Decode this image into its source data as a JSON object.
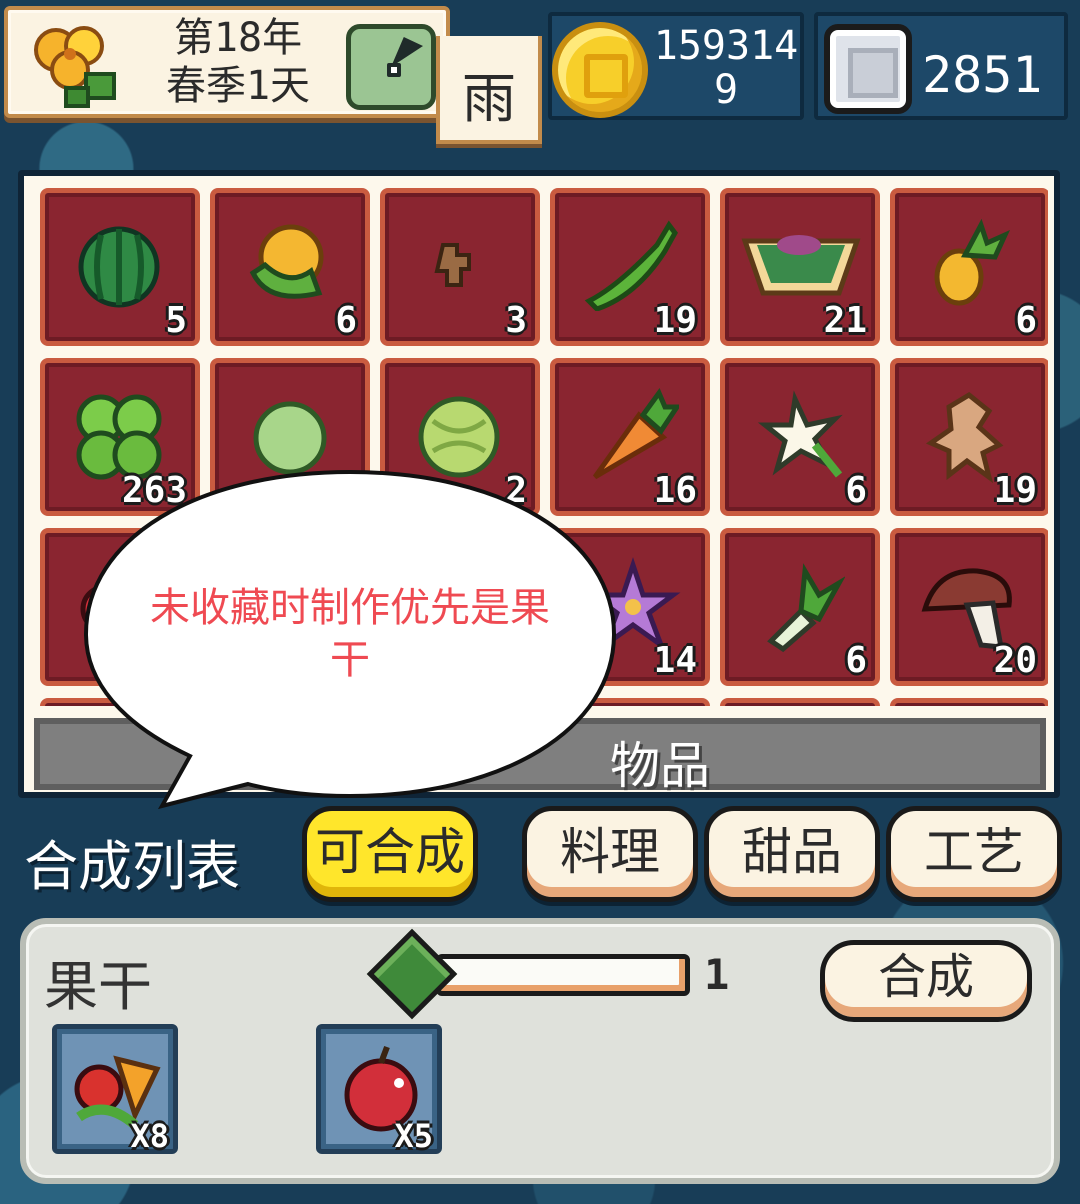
{
  "hud": {
    "date": {
      "year": "第18年",
      "season_day": "春季1天"
    },
    "weather": "雨",
    "coins": "1593149",
    "gems": "2851"
  },
  "inventory": {
    "label": "物品",
    "items": [
      {
        "icon": "watermelon-icon",
        "count": "5"
      },
      {
        "icon": "corn-icon",
        "count": "6"
      },
      {
        "icon": "ginger-root-icon",
        "count": "3"
      },
      {
        "icon": "pepper-icon",
        "count": "19"
      },
      {
        "icon": "salad-bowl-icon",
        "count": "21"
      },
      {
        "icon": "pineapple-icon",
        "count": "6"
      },
      {
        "icon": "clover-herb-icon",
        "count": "263"
      },
      {
        "icon": "cabbage-icon",
        "count": ""
      },
      {
        "icon": "melon-icon",
        "count": "2"
      },
      {
        "icon": "carrot-icon",
        "count": "16"
      },
      {
        "icon": "white-flower-icon",
        "count": "6"
      },
      {
        "icon": "ginseng-icon",
        "count": "19"
      },
      {
        "icon": "red-berry-icon",
        "count": ""
      },
      {
        "icon": "hidden-item-icon",
        "count": ""
      },
      {
        "icon": "hidden-item-icon",
        "count": ""
      },
      {
        "icon": "purple-flower-icon",
        "count": "14"
      },
      {
        "icon": "scallion-icon",
        "count": "6"
      },
      {
        "icon": "mushroom-icon",
        "count": "20"
      }
    ]
  },
  "crafting": {
    "title": "合成列表",
    "tabs": [
      "可合成",
      "料理",
      "甜品",
      "工艺"
    ],
    "active_tab": "可合成",
    "recipe": {
      "name": "果干",
      "quantity": "1",
      "craft_label": "合成",
      "ingredients": [
        {
          "icon": "mixed-fruit-icon",
          "multiplier": "X8"
        },
        {
          "icon": "apple-icon",
          "multiplier": "X5"
        }
      ]
    }
  },
  "annotation": {
    "text": "未收藏时制作优先是果干"
  },
  "colors": {
    "slot_bg": "#8a2530",
    "slot_border": "#c95b40",
    "active_tab": "#ffe62b",
    "annotation_text": "#ef4a52",
    "background": "#183d57"
  }
}
